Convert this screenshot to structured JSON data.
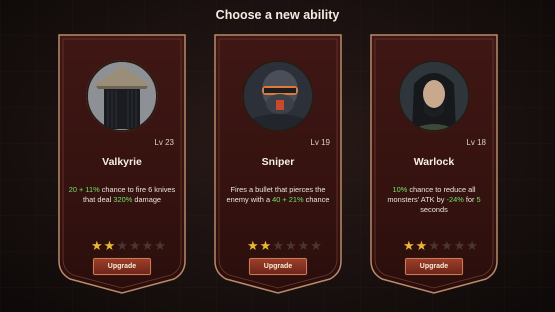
{
  "title": "Choose a new ability",
  "colors": {
    "highlight_green": "#6fe06a",
    "star_on": "#e9b832",
    "star_off": "#4a3630",
    "card_bg": "#3a1413",
    "card_border": "#b88a6a"
  },
  "cards": [
    {
      "name": "Valkyrie",
      "level": "Lv 23",
      "desc_parts": [
        {
          "t": "20 + 11%",
          "g": true
        },
        {
          "t": " chance to fire 6 knives that deal ",
          "g": false
        },
        {
          "t": "320%",
          "g": true
        },
        {
          "t": " damage",
          "g": false
        }
      ],
      "stars": 2,
      "stars_total": 6,
      "button": "Upgrade",
      "portrait_icon": "valkyrie-portrait-icon"
    },
    {
      "name": "Sniper",
      "level": "Lv 19",
      "desc_parts": [
        {
          "t": "Fires a bullet that pierces the enemy with a ",
          "g": false
        },
        {
          "t": "40 + 21%",
          "g": true
        },
        {
          "t": " chance",
          "g": false
        }
      ],
      "stars": 2,
      "stars_total": 6,
      "button": "Upgrade",
      "portrait_icon": "sniper-portrait-icon"
    },
    {
      "name": "Warlock",
      "level": "Lv 18",
      "desc_parts": [
        {
          "t": "10%",
          "g": true
        },
        {
          "t": " chance to reduce all monsters' ATK by ",
          "g": false
        },
        {
          "t": "-24%",
          "g": true
        },
        {
          "t": " for ",
          "g": false
        },
        {
          "t": "5",
          "g": true
        },
        {
          "t": " seconds",
          "g": false
        }
      ],
      "stars": 2,
      "stars_total": 6,
      "button": "Upgrade",
      "portrait_icon": "warlock-portrait-icon"
    }
  ]
}
